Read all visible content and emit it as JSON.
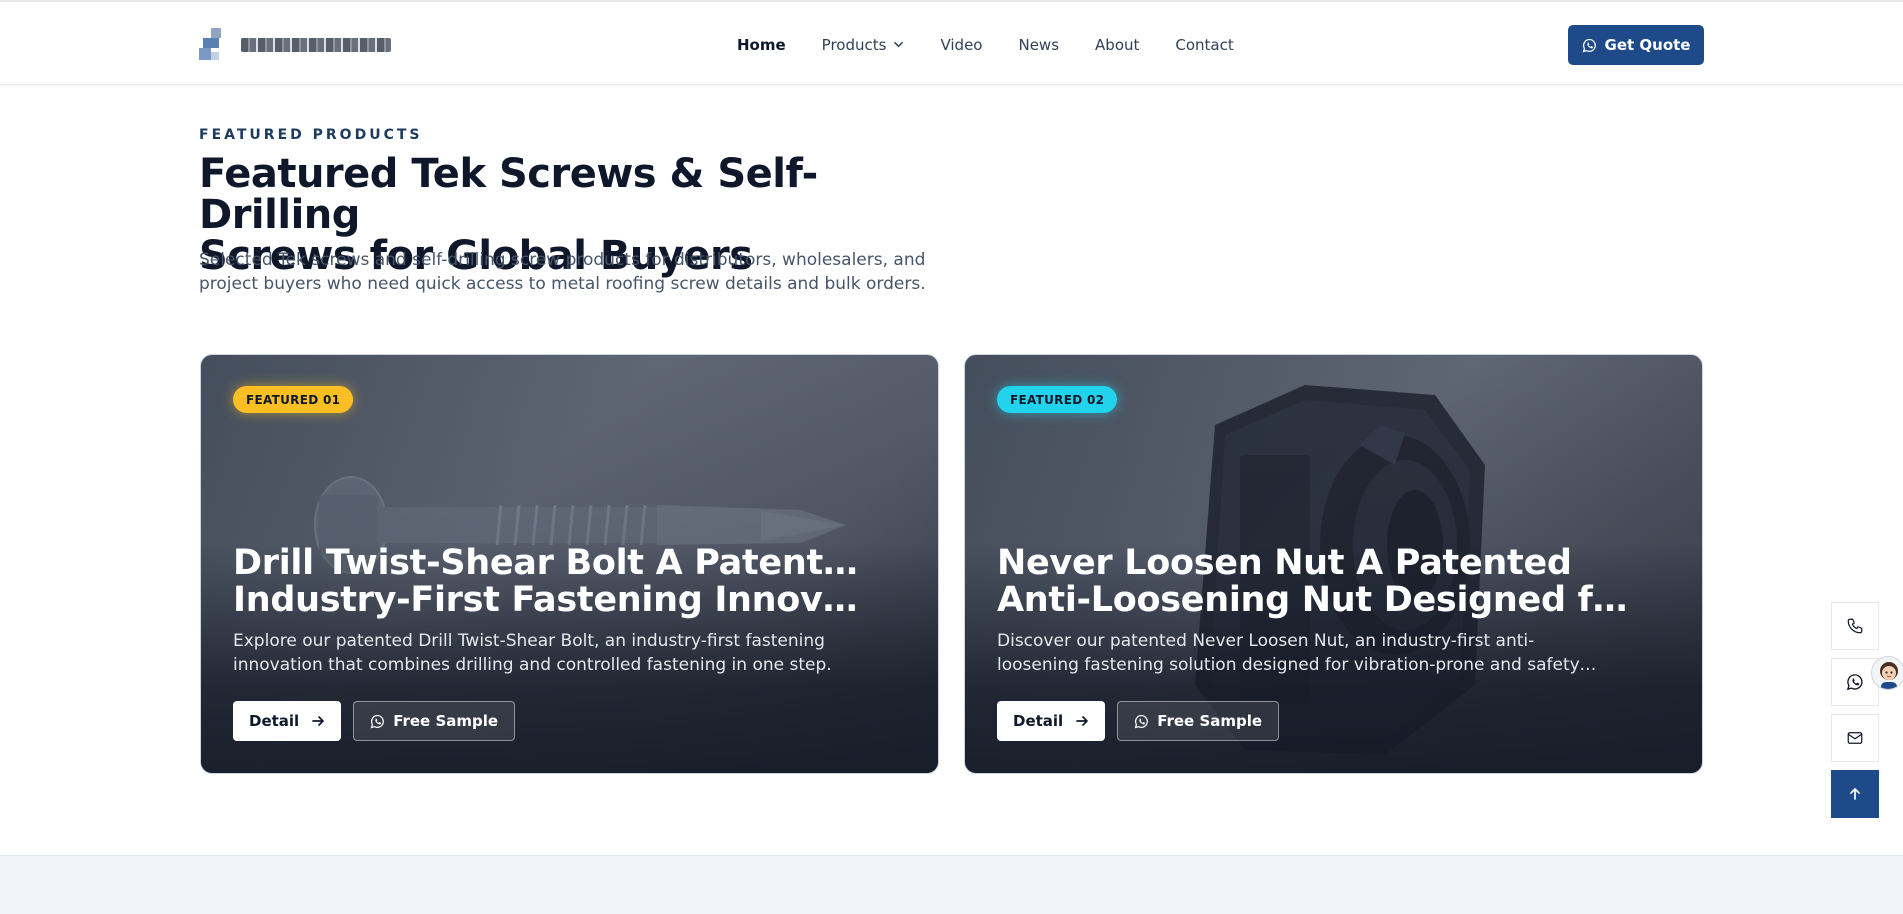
{
  "header": {
    "logo_alt": "",
    "nav": [
      {
        "label": "Home",
        "active": true
      },
      {
        "label": "Products",
        "has_dropdown": true
      },
      {
        "label": "Video"
      },
      {
        "label": "News"
      },
      {
        "label": "About"
      },
      {
        "label": "Contact"
      }
    ],
    "cta_label": "Get Quote",
    "cta_icon": "whatsapp-icon"
  },
  "section": {
    "eyebrow": "FEATURED PRODUCTS",
    "title_line1": "Featured Tek Screws & Self-Drilling",
    "title_line2": "Screws for Global Buyers",
    "description": "Selected Tek screws and self-drilling screw products for distributors, wholesalers, and project buyers who need quick access to metal roofing screw details and bulk orders."
  },
  "cards": [
    {
      "badge": "FEATURED 01",
      "badge_color": "#fbbf24",
      "title_line1": "Drill Twist-Shear Bolt A Patented,",
      "title_line2": "Industry-First Fastening Innovation",
      "desc_line1": "Explore our patented Drill Twist-Shear Bolt, an industry-first fastening",
      "desc_line2": "innovation that combines drilling and controlled fastening in one step.",
      "detail_label": "Detail",
      "sample_label": "Free Sample"
    },
    {
      "badge": "FEATURED 02",
      "badge_color": "#22d3ee",
      "title_line1": "Never Loosen Nut A Patented",
      "title_line2": "Anti-Loosening Nut Designed for Vibration",
      "desc_line1": "Discover our patented Never Loosen Nut, an industry-first anti-",
      "desc_line2": "loosening fastening solution designed for vibration-prone and safety-critical use.",
      "detail_label": "Detail",
      "sample_label": "Free Sample"
    }
  ],
  "floating": {
    "icons": [
      "phone-icon",
      "whatsapp-icon",
      "mail-icon",
      "arrow-up-icon"
    ],
    "accent": "#1e4a8a"
  },
  "colors": {
    "brand": "#1e4a8a",
    "heading": "#0f172a",
    "badge_yellow": "#fbbf24",
    "badge_cyan": "#22d3ee"
  }
}
